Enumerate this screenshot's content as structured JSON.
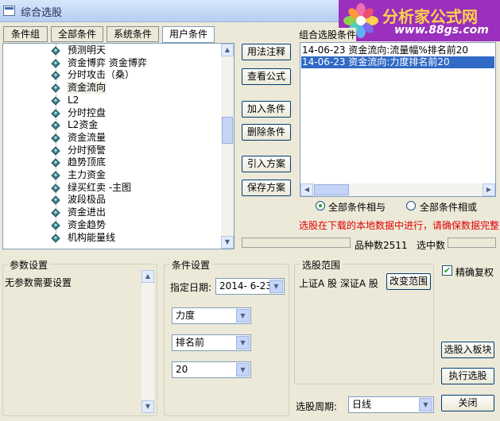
{
  "window": {
    "title": "综合选股"
  },
  "logo": {
    "main": "分析家公式网",
    "url": "www.88gs.com"
  },
  "tabs": [
    "条件组",
    "全部条件",
    "系统条件",
    "用户条件"
  ],
  "tree": {
    "items": [
      "预测明天",
      "资金博弈 资金博弈",
      "分时攻击（桑）",
      "资金流向",
      "L2",
      "分时控盘",
      "L2资金",
      "资金流量",
      "分时预警",
      "趋势顶底",
      "主力资金",
      "绿买红卖 -主图",
      "波段极品",
      "资金进出",
      "资金趋势",
      "机构能量线"
    ],
    "selected_index": 3
  },
  "buttons": {
    "usage_note": "用法注释",
    "view_formula": "查看公式",
    "add_condition": "加入条件",
    "delete_condition": "删除条件",
    "import_plan": "引入方案",
    "save_plan": "保存方案",
    "change_range": "改变范围",
    "to_board": "选股入板块",
    "execute": "执行选股",
    "close": "关闭"
  },
  "combo_conditions": {
    "label": "组合选股条件",
    "items": [
      "14-06-23 资金流向:流量幅%排名前20",
      "14-06-23 资金流向:力度排名前20"
    ],
    "selected_index": 1
  },
  "logic": {
    "and_label": "全部条件相与",
    "or_label": "全部条件相或",
    "selected": "and"
  },
  "warning": "选股在下载的本地数据中进行，请确保数据完整",
  "status": {
    "count_label": "品种数",
    "count_value": "2511",
    "selected_label": "选中数",
    "selected_value": ""
  },
  "params": {
    "title": "参数设置",
    "text": "无参数需要设置"
  },
  "condition_settings": {
    "title": "条件设置",
    "date_label": "指定日期:",
    "date_value": "2014- 6-23",
    "field1": "力度",
    "field2": "排名前",
    "field3": "20"
  },
  "range": {
    "title": "选股范围",
    "text": "上证A 股 深证A 股"
  },
  "adjust": {
    "label": "精确复权",
    "checked": true
  },
  "period": {
    "label": "选股周期:",
    "value": "日线"
  },
  "colors": {
    "warning": "#e00000",
    "selection": "#316ac5",
    "logo_bg": "#9b2fbe"
  }
}
